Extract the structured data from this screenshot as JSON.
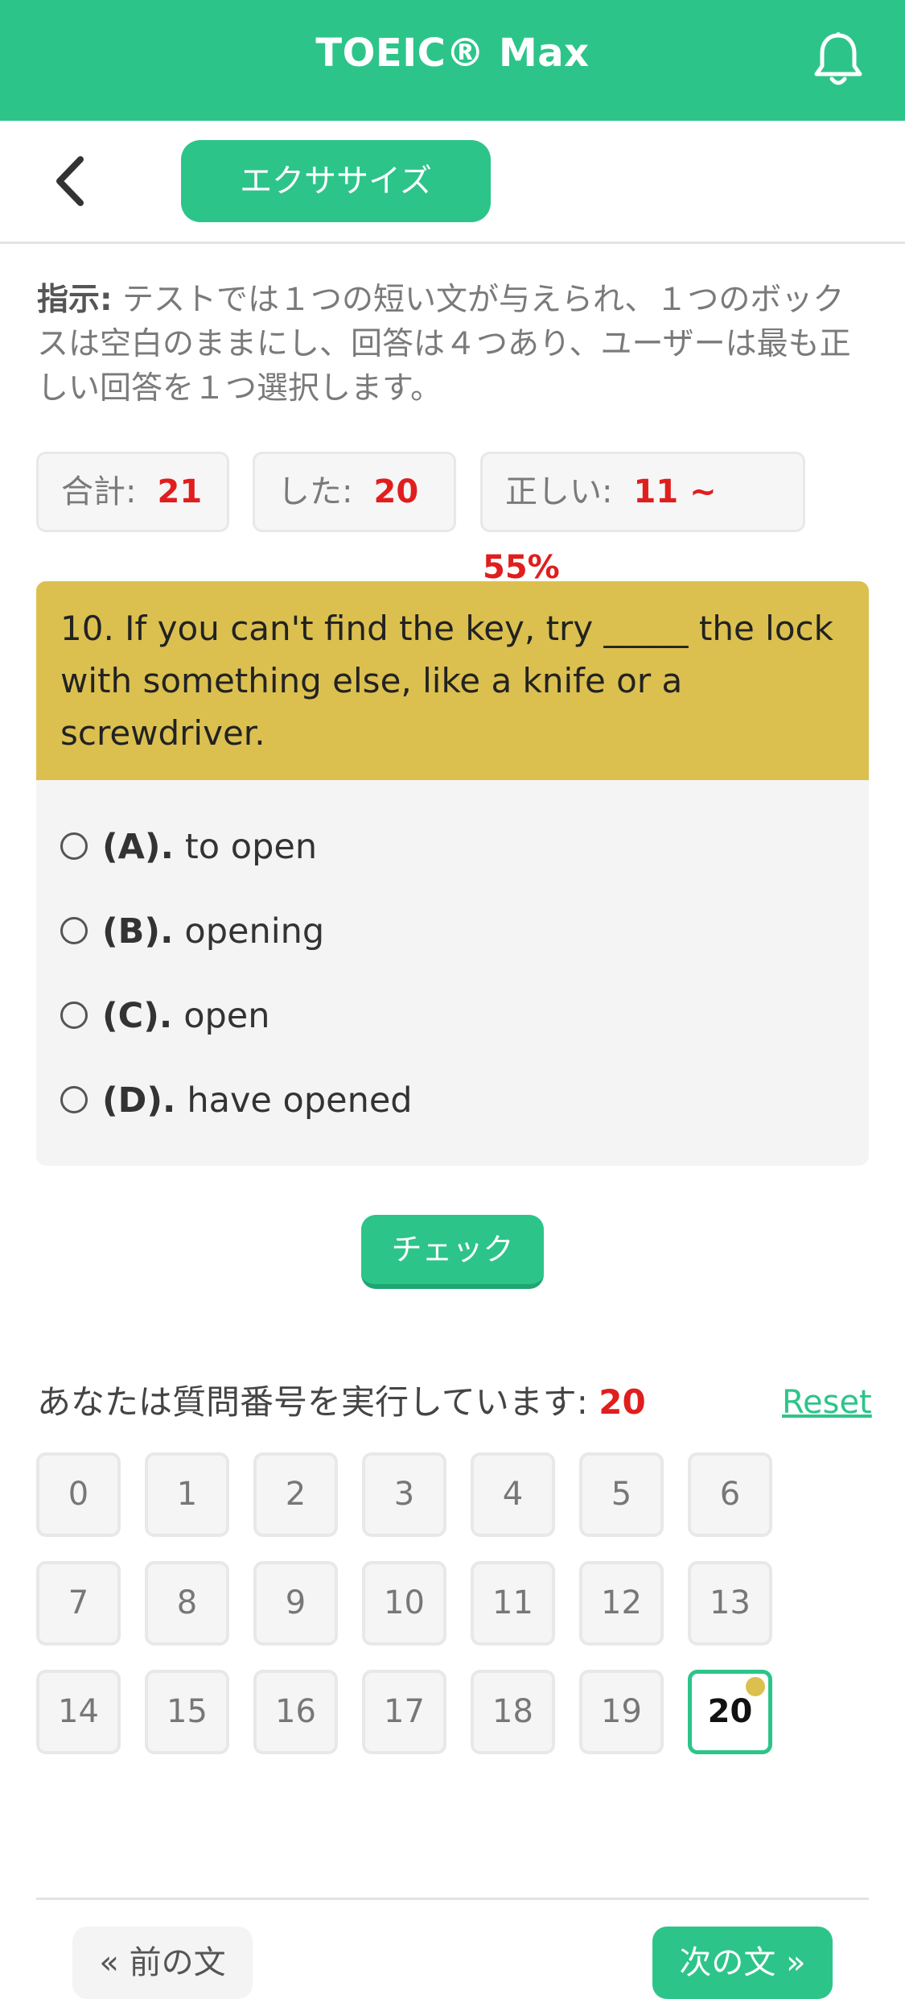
{
  "app": {
    "title": "TOEIC® Max",
    "notification_icon": "bell-icon",
    "accent_color": "#2dc48a",
    "highlight_color": "#dbc050",
    "error_color": "#e01e1e"
  },
  "nav": {
    "back_icon": "chevron-left-icon",
    "tab_label": "エクササイズ"
  },
  "instruction": {
    "label": "指示:",
    "text": " テストでは１つの短い文が与えられ、１つのボックスは空白のままにし、回答は４つあり、ユーザーは最も正しい回答を１つ選択します。"
  },
  "stats": {
    "total_label": "合計:",
    "total_value": "21",
    "done_label": "した:",
    "done_value": "20",
    "correct_label": "正しい:",
    "correct_value": "11 ~ 55%"
  },
  "question": {
    "text": "10. If you can't find the key, try _____ the lock with something else, like a knife or a screwdriver.",
    "options": [
      {
        "letter": "(A).",
        "text": "to open"
      },
      {
        "letter": "(B).",
        "text": "opening"
      },
      {
        "letter": "(C).",
        "text": "open"
      },
      {
        "letter": "(D).",
        "text": "have opened"
      }
    ]
  },
  "check_button": "チェック",
  "progress": {
    "running_label": "あなたは質問番号を実行しています: ",
    "current": "20",
    "reset_label": "Reset",
    "numbers": [
      "0",
      "1",
      "2",
      "3",
      "4",
      "5",
      "6",
      "7",
      "8",
      "9",
      "10",
      "11",
      "12",
      "13",
      "14",
      "15",
      "16",
      "17",
      "18",
      "19",
      "20"
    ]
  },
  "footer": {
    "prev_label": "« 前の文",
    "next_label": "次の文 »"
  }
}
